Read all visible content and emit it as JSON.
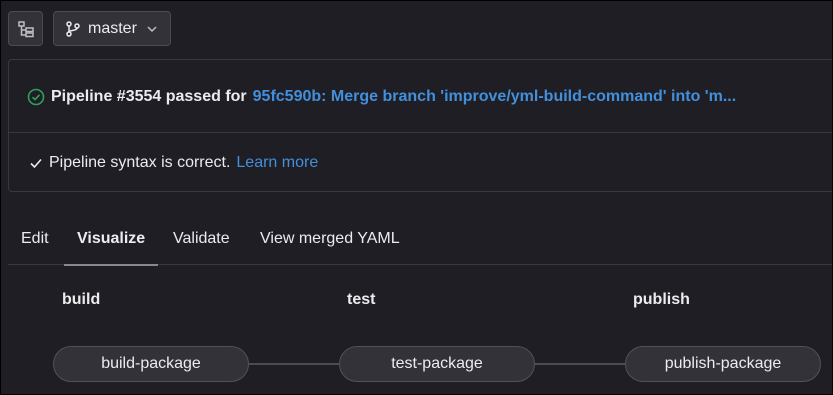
{
  "toolbar": {
    "sidebar_toggle_icon": "file-tree-icon",
    "branch_icon": "branch-icon",
    "branch": "master",
    "chevron_icon": "chevron-down-icon"
  },
  "status_card": {
    "status_icon": "check-circle-icon",
    "status_text": "Pipeline #3554 passed for",
    "commit_text": "95fc590b: Merge branch 'improve/yml-build-command' into 'm...",
    "syntax_icon": "check-icon",
    "syntax_text": "Pipeline syntax is correct.",
    "learn_more": "Learn more"
  },
  "tabs": [
    {
      "label": "Edit",
      "active": false
    },
    {
      "label": "Visualize",
      "active": true
    },
    {
      "label": "Validate",
      "active": false
    },
    {
      "label": "View merged YAML",
      "active": false
    }
  ],
  "stages": [
    {
      "title": "build",
      "jobs": [
        "build-package"
      ]
    },
    {
      "title": "test",
      "jobs": [
        "test-package"
      ]
    },
    {
      "title": "publish",
      "jobs": [
        "publish-package"
      ]
    }
  ],
  "colors": {
    "background": "#1f1e24",
    "link": "#428fdc",
    "success": "#2da160",
    "button": "#333238"
  }
}
